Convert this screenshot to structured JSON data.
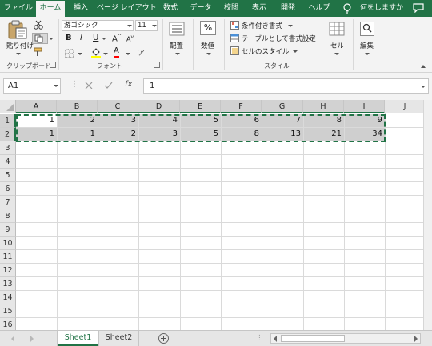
{
  "tabs": [
    {
      "label": "ファイル"
    },
    {
      "label": "ホーム"
    },
    {
      "label": "挿入"
    },
    {
      "label": "ページ レイアウト"
    },
    {
      "label": "数式"
    },
    {
      "label": "データ"
    },
    {
      "label": "校閲"
    },
    {
      "label": "表示"
    },
    {
      "label": "開発"
    },
    {
      "label": "ヘルプ"
    }
  ],
  "active_tab": "ホーム",
  "tell_me": "何をしますか",
  "ribbon": {
    "clipboard": {
      "paste_label": "貼り付け",
      "group_label": "クリップボード"
    },
    "font": {
      "font_name": "游ゴシック",
      "font_size": "11",
      "group_label": "フォント"
    },
    "alignment": {
      "label": "配置"
    },
    "number": {
      "label": "数値",
      "symbol": "%"
    },
    "styles": {
      "conditional": "条件付き書式",
      "table": "テーブルとして書式設定",
      "cell_styles": "セルのスタイル",
      "group_label": "スタイル"
    },
    "cells": {
      "label": "セル"
    },
    "editing": {
      "label": "編集"
    }
  },
  "formula_bar": {
    "name_box": "A1",
    "formula": "1",
    "fx": "fx"
  },
  "columns": [
    "A",
    "B",
    "C",
    "D",
    "E",
    "F",
    "G",
    "H",
    "I",
    "J"
  ],
  "rows": [
    "1",
    "2",
    "3",
    "4",
    "5",
    "6",
    "7",
    "8",
    "9",
    "10",
    "11",
    "12",
    "13",
    "14",
    "15",
    "16"
  ],
  "cells": {
    "row1": [
      "1",
      "2",
      "3",
      "4",
      "5",
      "6",
      "7",
      "8",
      "9"
    ],
    "row2": [
      "1",
      "1",
      "2",
      "3",
      "5",
      "8",
      "13",
      "21",
      "34"
    ]
  },
  "sheets": [
    {
      "label": "Sheet1",
      "active": true
    },
    {
      "label": "Sheet2",
      "active": false
    }
  ],
  "colors": {
    "accent": "#217346",
    "selection": "#cfcfcf",
    "header": "#e6e6e6"
  }
}
